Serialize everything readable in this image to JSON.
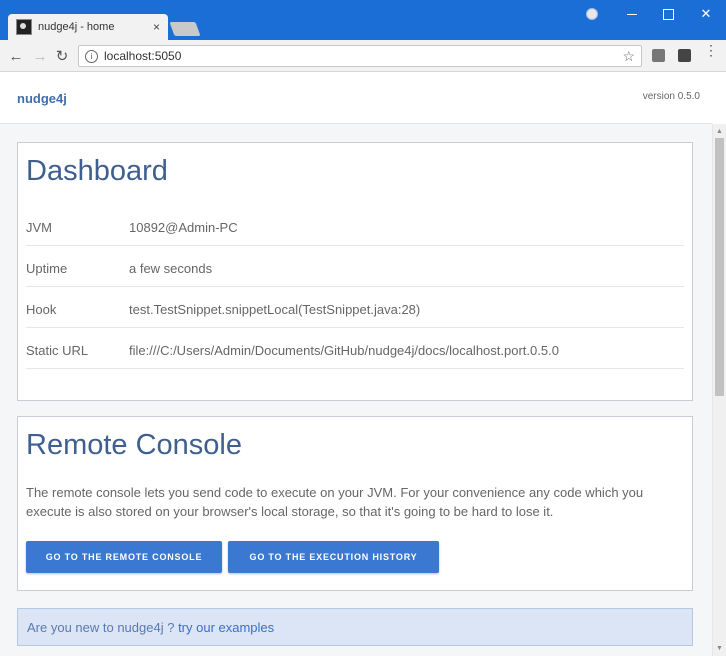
{
  "browser": {
    "tab_title": "nudge4j - home",
    "tab_close": "×",
    "url": "localhost:5050",
    "info_glyph": "i",
    "star_glyph": "☆",
    "back_glyph": "←",
    "forward_glyph": "→",
    "reload_glyph": "↻",
    "close_glyph": "✕",
    "menu_glyph": "⋮"
  },
  "app": {
    "brand": "nudge4j",
    "version": "version 0.5.0"
  },
  "dashboard": {
    "title": "Dashboard",
    "rows": [
      {
        "label": "JVM",
        "value": "10892@Admin-PC"
      },
      {
        "label": "Uptime",
        "value": "a few seconds"
      },
      {
        "label": "Hook",
        "value": "test.TestSnippet.snippetLocal(TestSnippet.java:28)"
      },
      {
        "label": "Static URL",
        "value": "file:///C:/Users/Admin/Documents/GitHub/nudge4j/docs/localhost.port.0.5.0"
      }
    ]
  },
  "console": {
    "title": "Remote Console",
    "description": "The remote console lets you send code to execute on your JVM. For your convenience any code which you execute is also stored on your browser's local storage, so that it's going to be hard to lose it.",
    "button_console": "GO TO THE REMOTE CONSOLE",
    "button_history": "GO TO THE EXECUTION HISTORY"
  },
  "banner": {
    "text": "Are you new to nudge4j ?",
    "link": "try our examples"
  },
  "colors": {
    "titlebar": "#1b6ed6",
    "accent": "#3a78d1",
    "heading": "#3f5f8f",
    "banner_bg": "#dbe5f5"
  }
}
